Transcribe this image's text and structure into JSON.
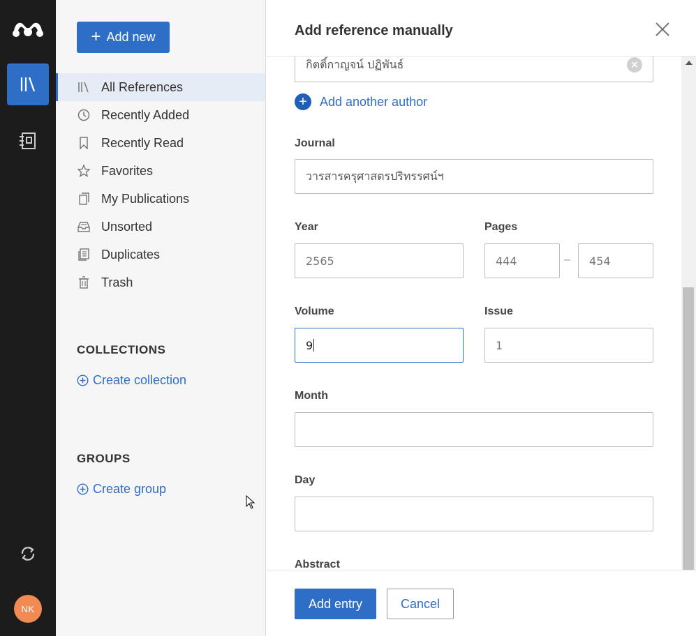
{
  "rail": {
    "avatar_initials": "NK"
  },
  "sidebar": {
    "add_new_label": "Add new",
    "items": [
      {
        "label": "All References",
        "icon": "library-icon"
      },
      {
        "label": "Recently Added",
        "icon": "clock-icon"
      },
      {
        "label": "Recently Read",
        "icon": "bookmark-icon"
      },
      {
        "label": "Favorites",
        "icon": "star-icon"
      },
      {
        "label": "My Publications",
        "icon": "publications-icon"
      },
      {
        "label": "Unsorted",
        "icon": "inbox-icon"
      },
      {
        "label": "Duplicates",
        "icon": "duplicates-icon"
      },
      {
        "label": "Trash",
        "icon": "trash-icon"
      }
    ],
    "collections_heading": "COLLECTIONS",
    "create_collection": "Create collection",
    "groups_heading": "GROUPS",
    "create_group": "Create group"
  },
  "dialog": {
    "title": "Add reference manually",
    "author_value": "กิตติ์กาญจน์ ปฏิพันธ์",
    "add_author_label": "Add another author",
    "journal_label": "Journal",
    "journal_value": "วารสารครุศาสตรปริทรรศน์ฯ",
    "year_label": "Year",
    "year_value": "2565",
    "pages_label": "Pages",
    "pages_from": "444",
    "pages_to": "454",
    "pages_separator": "–",
    "volume_label": "Volume",
    "volume_value": "9",
    "issue_label": "Issue",
    "issue_value": "1",
    "month_label": "Month",
    "month_value": "",
    "day_label": "Day",
    "day_value": "",
    "abstract_label": "Abstract",
    "add_entry_label": "Add entry",
    "cancel_label": "Cancel"
  },
  "colors": {
    "accent": "#2f6ec7",
    "rail": "#1c1c1c",
    "sidebar": "#f6f6f6",
    "avatar": "#f28a54"
  }
}
